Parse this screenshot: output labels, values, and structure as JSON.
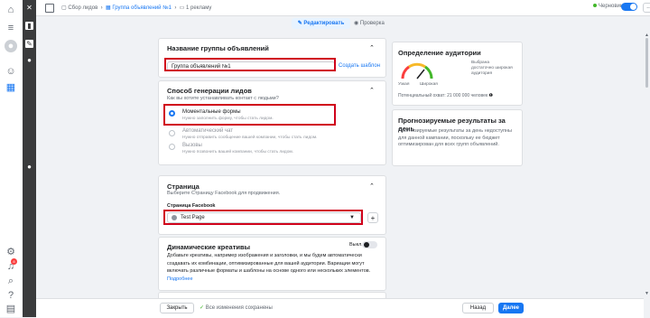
{
  "topbar": {
    "breadcrumb_campaign": "Сбор лидов",
    "breadcrumb_adset": "Группа объявлений №1",
    "breadcrumb_ad": "1 рекламу",
    "status": "Черновик",
    "more": "..."
  },
  "modebar": {
    "edit_label": "Редактировать",
    "review_label": "Проверка"
  },
  "adset_name": {
    "title": "Название группы объявлений",
    "value": "Группа объявлений №1",
    "template_link": "Создать шаблон"
  },
  "lead_method": {
    "title": "Способ генерации лидов",
    "subtitle": "Как вы хотите устанавливать контакт с людьми?",
    "options": [
      {
        "label": "Моментальные формы",
        "desc": "Нужно заполнить форму, чтобы стать лидом."
      },
      {
        "label": "Автоматический чат",
        "desc": "Нужно отправить сообщение вашей компании, чтобы стать лидом."
      },
      {
        "label": "Вызовы",
        "desc": "Нужно позвонить вашей компании, чтобы стать лидом."
      }
    ]
  },
  "page_section": {
    "title": "Страница",
    "subtitle": "Выберите Страницу Facebook для продвижения.",
    "field_label": "Страница Facebook",
    "selected": "Test Page",
    "add": "+"
  },
  "dynamic": {
    "title": "Динамические креативы",
    "toggle_label": "Выкл.",
    "desc": "Добавьте креативы, например изображения и заголовки, и мы будем автоматически создавать их комбинации, оптимизированные для вашей аудитории. Вариации могут включать различные форматы и шаблоны на основе одного или нескольких элементов.",
    "more_link": "Подробнее"
  },
  "audience": {
    "title": "Определение аудитории",
    "gauge_left": "Узкая",
    "gauge_right": "Широкая",
    "gauge_desc": "Выбрана достаточно широкая аудитория",
    "reach": "Потенциальный охват: 21 000 000 человек"
  },
  "forecast": {
    "title": "Прогнозируемые результаты за день",
    "desc": "Прогнозируемые результаты за день недоступны для данной кампании, поскольку ее бюджет оптимизирован для всех групп объявлений."
  },
  "footer": {
    "close": "Закрыть",
    "saved": "Все изменения сохранены",
    "back": "Назад",
    "next": "Далее"
  },
  "colors": {
    "accent": "#1877f2",
    "highlight": "#d0021b",
    "saved": "#42b72a"
  }
}
